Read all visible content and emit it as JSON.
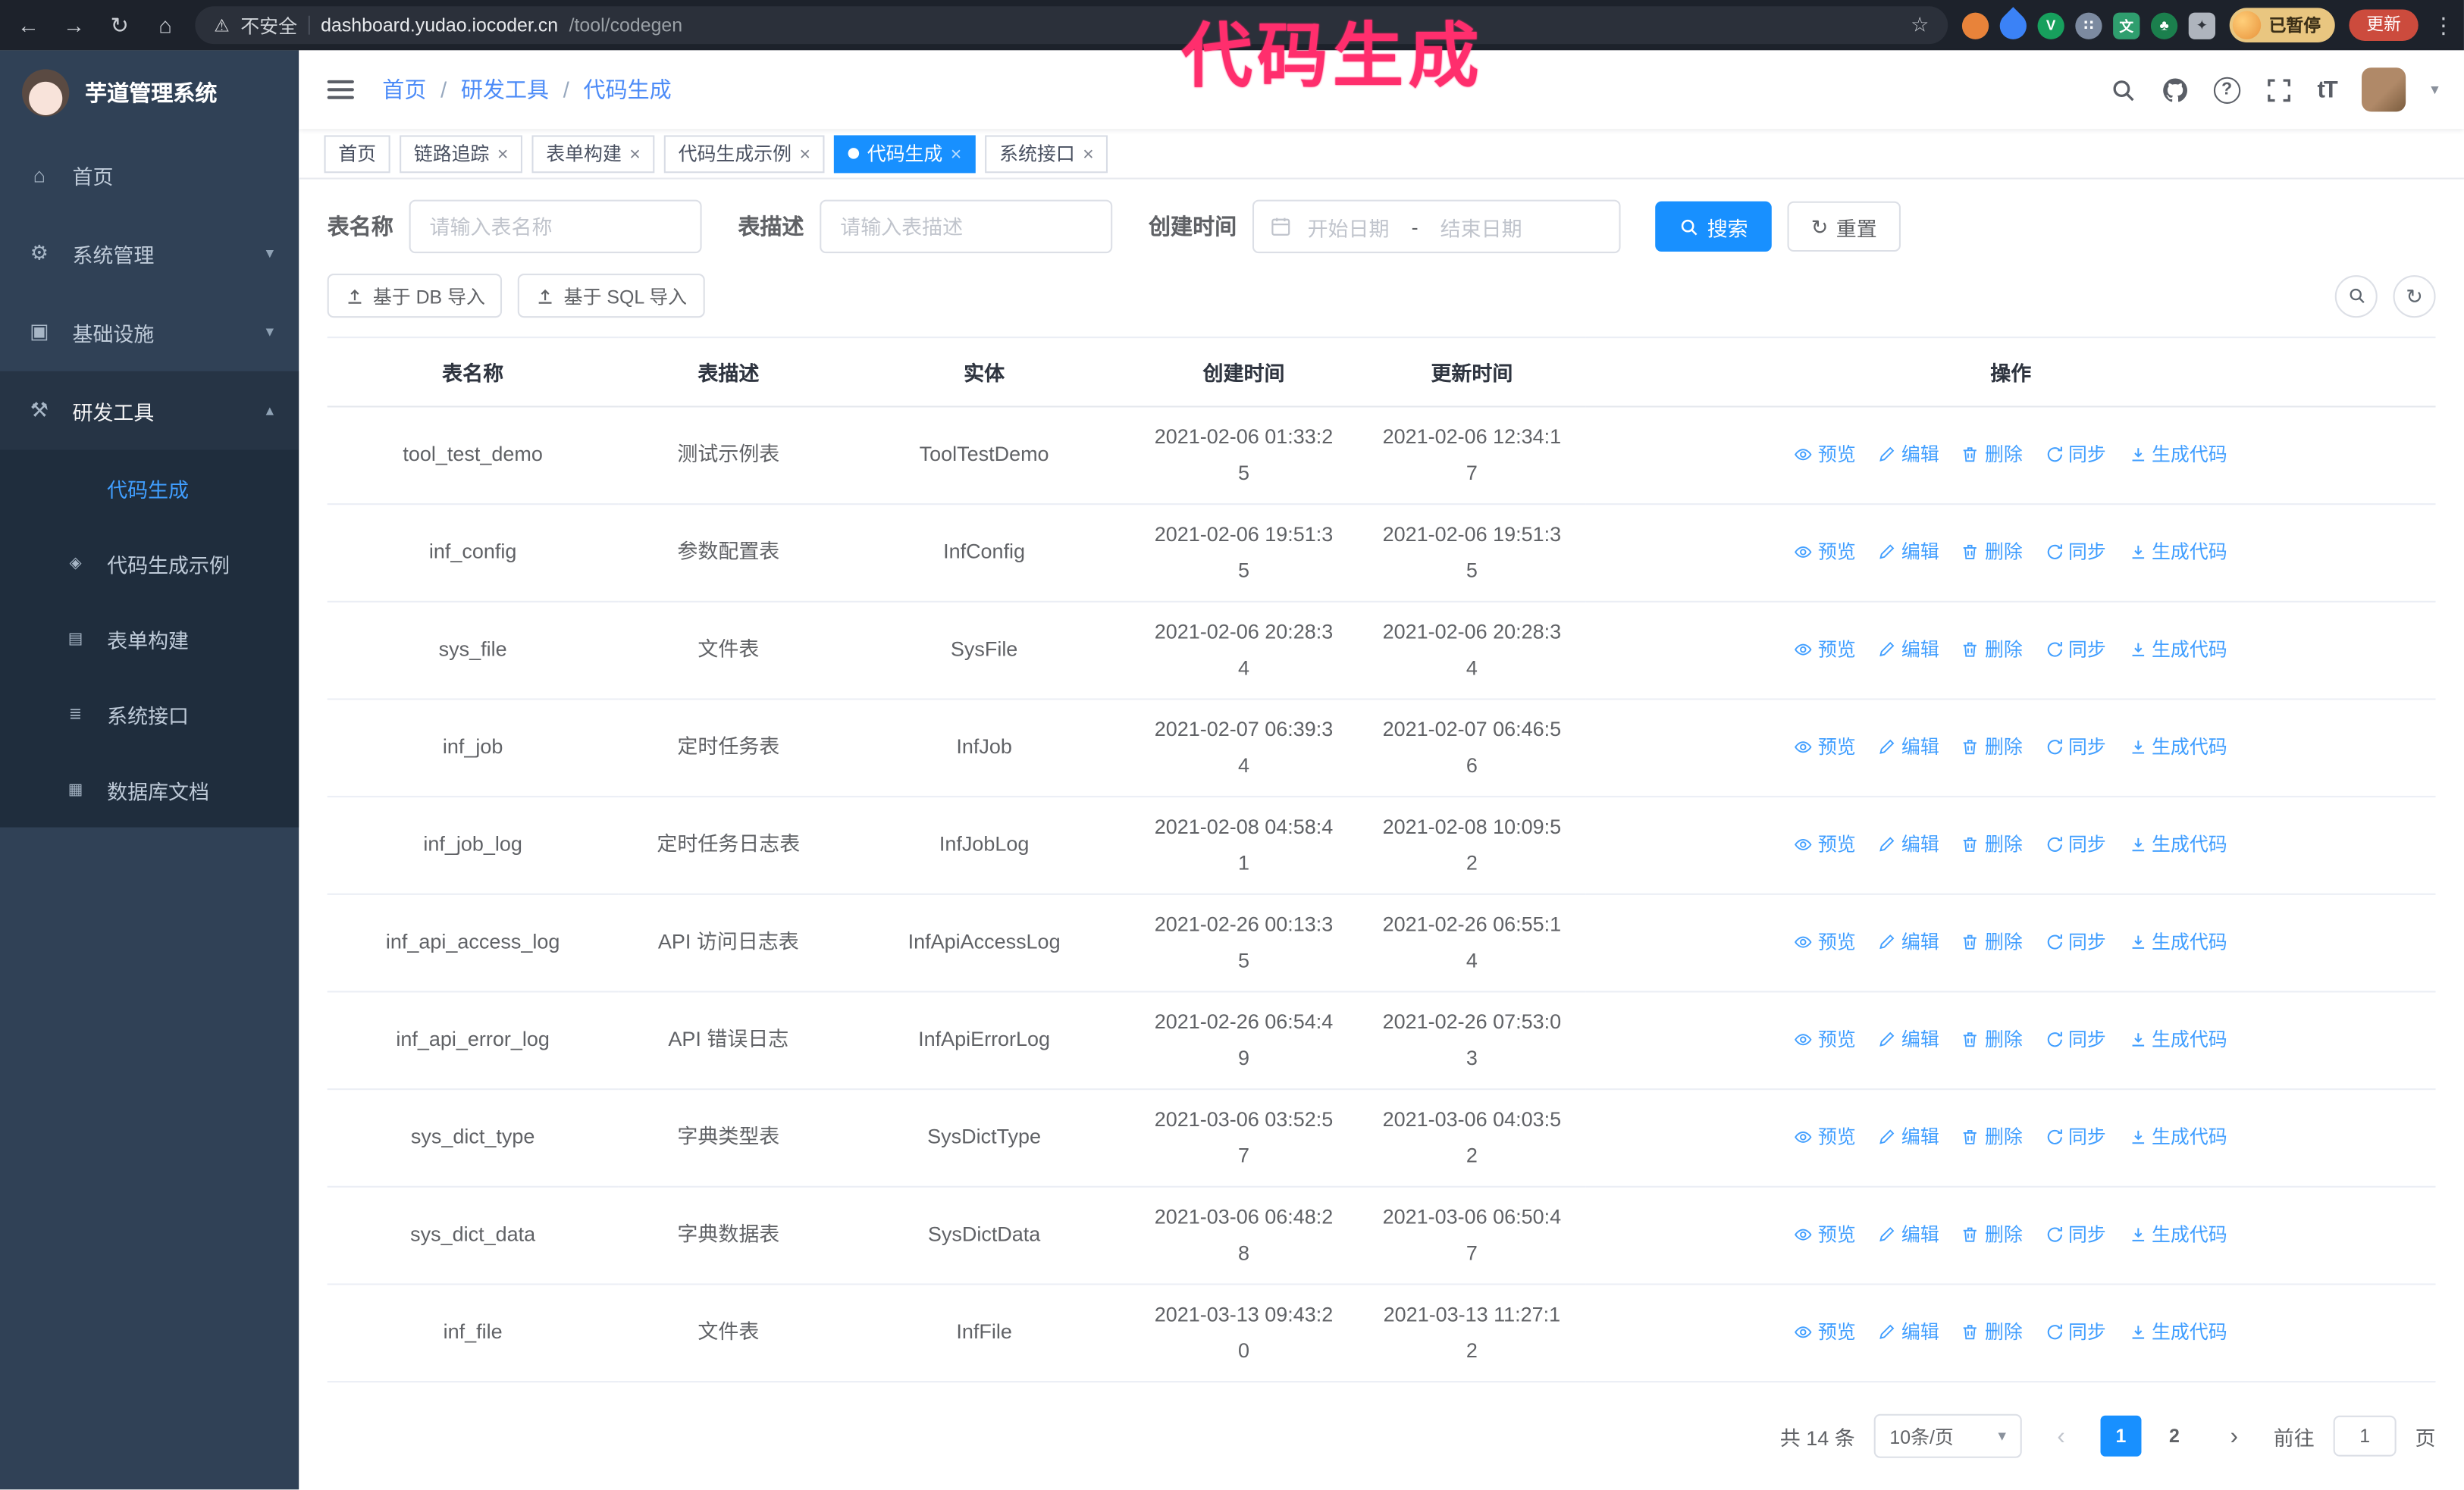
{
  "colors": {
    "accent": "#1890ff",
    "link": "#409eff",
    "annotation": "#ff2e6d",
    "sidebar_bg": "#304156",
    "submenu_bg": "#1f2d3d",
    "sidebar_active_bg": "#263445",
    "text_menu": "#bfcbd9",
    "browser_bar": "#1d222b",
    "update_pill": "#cc4b3d",
    "crumb": "#4c8bf7"
  },
  "icons": {
    "back": "←",
    "forward": "→",
    "reload": "↻",
    "home": "⌂",
    "warning": "⚠",
    "star": "☆",
    "kebab": "⋮",
    "caret_down": "▾",
    "chevron_down": "▾",
    "chevron_up": "▴",
    "question": "?",
    "font_size": "tT",
    "reset": "↻",
    "prev": "‹",
    "next": "›",
    "close": "×",
    "menu_home": "⌂",
    "menu_gear": "⚙",
    "menu_infra": "▣",
    "menu_tools": "⚒",
    "sub_code": "</>",
    "sub_example": "◈",
    "sub_form": "▤",
    "sub_api": "≣",
    "sub_db": "▦"
  },
  "annotation": {
    "text": "代码生成"
  },
  "browser": {
    "security_label": "不安全",
    "url_host": "dashboard.yudao.iocoder.cn",
    "url_path": "/tool/codegen",
    "profile_badge": "已暂停",
    "update_label": "更新",
    "extensions": [
      {
        "color": "#e8833a",
        "glyph": "",
        "shape": "circle"
      },
      {
        "color": "#3b82f6",
        "glyph": "",
        "shape": "drop"
      },
      {
        "color": "#17a05d",
        "glyph": "V",
        "shape": "circle"
      },
      {
        "color": "#7c8aa0",
        "glyph": "∷",
        "shape": "circle"
      },
      {
        "color": "#2f9e6e",
        "glyph": "文",
        "shape": "square"
      },
      {
        "color": "#1b7f4d",
        "glyph": "♣",
        "shape": "circle"
      },
      {
        "color": "#aeb4bd",
        "glyph": "✦",
        "shape": "puzzle"
      }
    ]
  },
  "sidebar": {
    "logo_title": "芋道管理系统",
    "items": [
      {
        "id": "home",
        "label": "首页",
        "icon": "menu_home"
      },
      {
        "id": "system-manage",
        "label": "系统管理",
        "icon": "menu_gear",
        "chevron": "down"
      },
      {
        "id": "infrastructure",
        "label": "基础设施",
        "icon": "menu_infra",
        "chevron": "down"
      },
      {
        "id": "dev-tools",
        "label": "研发工具",
        "icon": "menu_tools",
        "chevron": "up",
        "open": true
      }
    ],
    "subitems": [
      {
        "id": "codegen",
        "label": "代码生成",
        "icon": "sub_code",
        "active": true
      },
      {
        "id": "codegen-example",
        "label": "代码生成示例",
        "icon": "sub_example"
      },
      {
        "id": "form-builder",
        "label": "表单构建",
        "icon": "sub_form"
      },
      {
        "id": "system-api",
        "label": "系统接口",
        "icon": "sub_api"
      },
      {
        "id": "db-doc",
        "label": "数据库文档",
        "icon": "sub_db"
      }
    ]
  },
  "header": {
    "breadcrumb": [
      "首页",
      "研发工具",
      "代码生成"
    ]
  },
  "tabs": [
    {
      "label": "首页",
      "closable": false,
      "active": false
    },
    {
      "label": "链路追踪",
      "closable": true,
      "active": false
    },
    {
      "label": "表单构建",
      "closable": true,
      "active": false
    },
    {
      "label": "代码生成示例",
      "closable": true,
      "active": false
    },
    {
      "label": "代码生成",
      "closable": true,
      "active": true
    },
    {
      "label": "系统接口",
      "closable": true,
      "active": false
    }
  ],
  "filters": {
    "table_name_label": "表名称",
    "table_name_placeholder": "请输入表名称",
    "table_desc_label": "表描述",
    "table_desc_placeholder": "请输入表描述",
    "create_time_label": "创建时间",
    "date_start_placeholder": "开始日期",
    "date_separator": "-",
    "date_end_placeholder": "结束日期",
    "search_label": "搜索",
    "reset_label": "重置"
  },
  "toolbar": {
    "import_db_label": "基于 DB 导入",
    "import_sql_label": "基于 SQL 导入"
  },
  "table": {
    "columns": [
      "表名称",
      "表描述",
      "实体",
      "创建时间",
      "更新时间",
      "操作"
    ],
    "op_labels": [
      "预览",
      "编辑",
      "删除",
      "同步",
      "生成代码"
    ],
    "rows": [
      {
        "name": "tool_test_demo",
        "desc": "测试示例表",
        "entity": "ToolTestDemo",
        "created": "2021-02-06 01:33:25",
        "updated": "2021-02-06 12:34:17"
      },
      {
        "name": "inf_config",
        "desc": "参数配置表",
        "entity": "InfConfig",
        "created": "2021-02-06 19:51:35",
        "updated": "2021-02-06 19:51:35"
      },
      {
        "name": "sys_file",
        "desc": "文件表",
        "entity": "SysFile",
        "created": "2021-02-06 20:28:34",
        "updated": "2021-02-06 20:28:34"
      },
      {
        "name": "inf_job",
        "desc": "定时任务表",
        "entity": "InfJob",
        "created": "2021-02-07 06:39:34",
        "updated": "2021-02-07 06:46:56"
      },
      {
        "name": "inf_job_log",
        "desc": "定时任务日志表",
        "entity": "InfJobLog",
        "created": "2021-02-08 04:58:41",
        "updated": "2021-02-08 10:09:52"
      },
      {
        "name": "inf_api_access_log",
        "desc": "API 访问日志表",
        "entity": "InfApiAccessLog",
        "created": "2021-02-26 00:13:35",
        "updated": "2021-02-26 06:55:14"
      },
      {
        "name": "inf_api_error_log",
        "desc": "API 错误日志",
        "entity": "InfApiErrorLog",
        "created": "2021-02-26 06:54:49",
        "updated": "2021-02-26 07:53:03"
      },
      {
        "name": "sys_dict_type",
        "desc": "字典类型表",
        "entity": "SysDictType",
        "created": "2021-03-06 03:52:57",
        "updated": "2021-03-06 04:03:52"
      },
      {
        "name": "sys_dict_data",
        "desc": "字典数据表",
        "entity": "SysDictData",
        "created": "2021-03-06 06:48:28",
        "updated": "2021-03-06 06:50:47"
      },
      {
        "name": "inf_file",
        "desc": "文件表",
        "entity": "InfFile",
        "created": "2021-03-13 09:43:20",
        "updated": "2021-03-13 11:27:12"
      }
    ]
  },
  "pagination": {
    "total_label": "共 14 条",
    "page_size_label": "10条/页",
    "pages": [
      "1",
      "2"
    ],
    "active_page": "1",
    "goto_label": "前往",
    "goto_value": "1",
    "goto_suffix": "页"
  }
}
